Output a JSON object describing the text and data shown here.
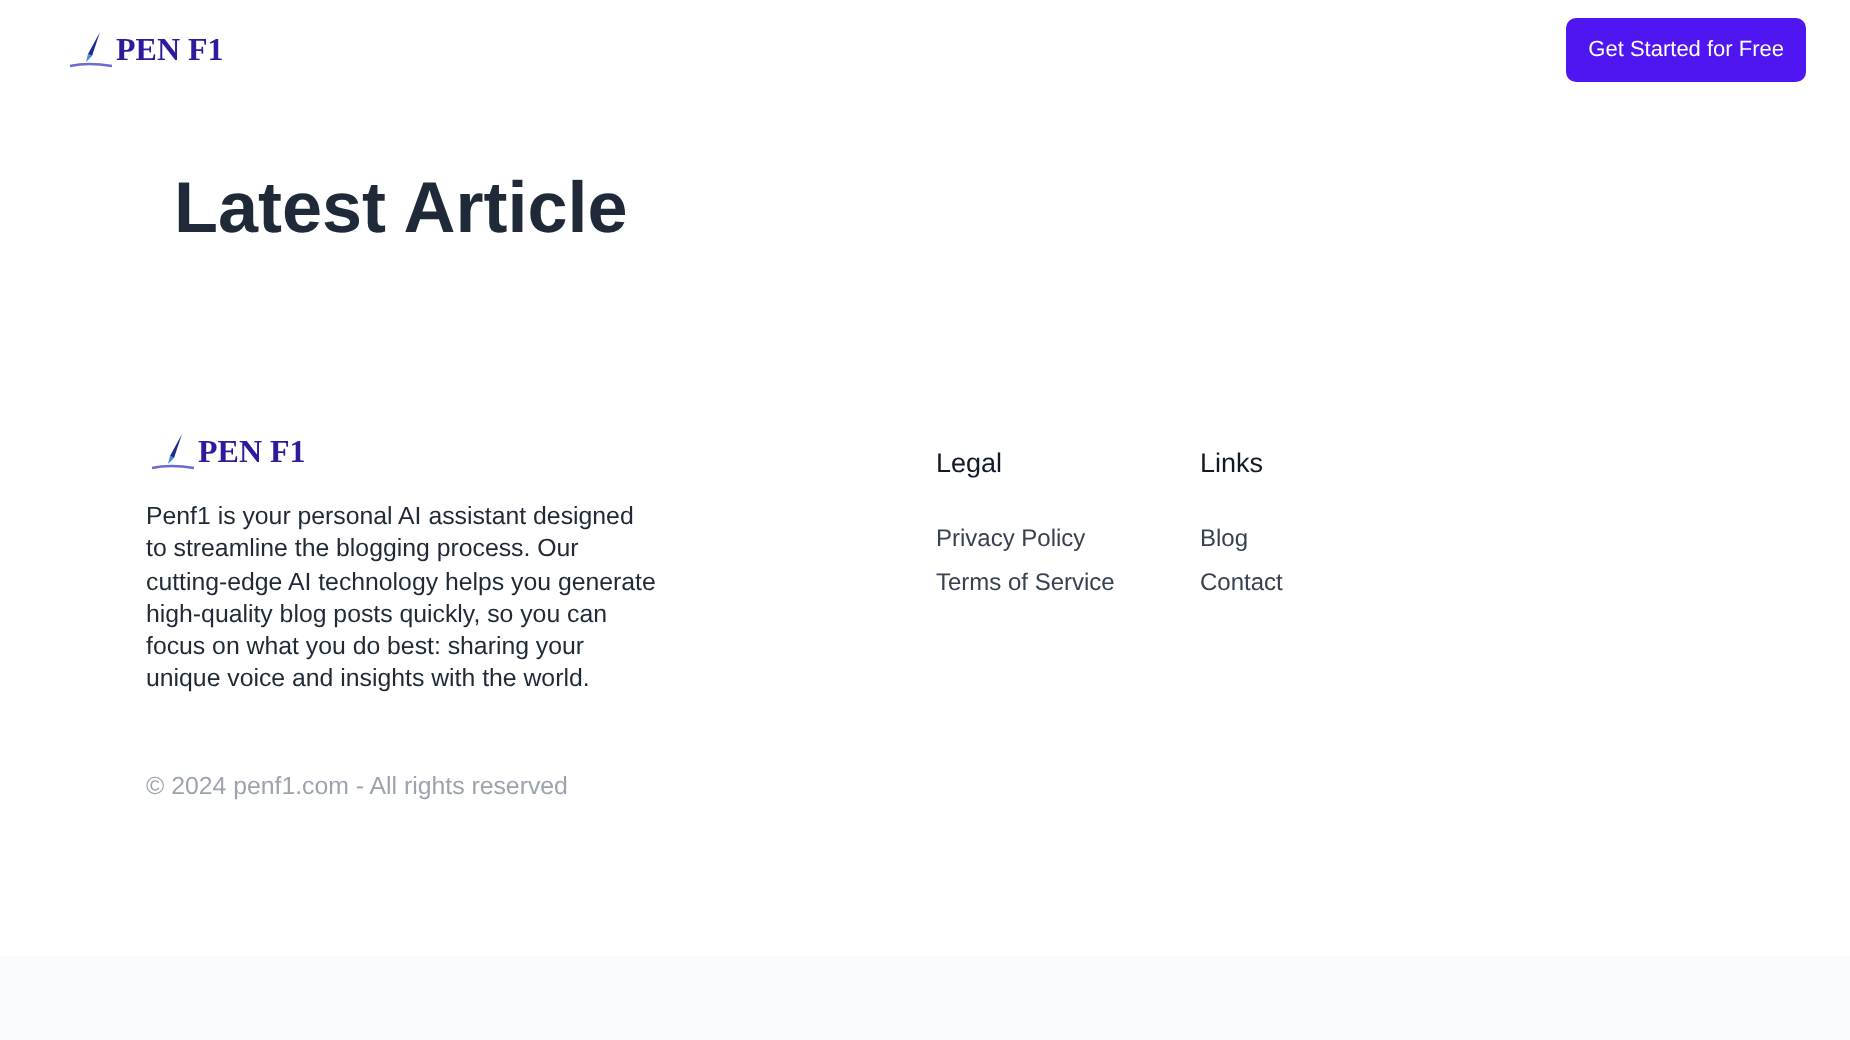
{
  "header": {
    "logo": "PEN F1",
    "cta": "Get Started for Free"
  },
  "heading": "Latest Article",
  "footer": {
    "logo": "PEN F1",
    "description": "Penf1 is your personal AI assistant designed to streamline the blogging process. Our cutting-edge AI technology helps you generate high-quality blog posts quickly, so you can focus on what you do best: sharing your unique voice and insights with the world.",
    "columns": [
      {
        "title": "Legal",
        "links": [
          "Privacy Policy",
          "Terms of Service"
        ]
      },
      {
        "title": "Links",
        "links": [
          "Blog",
          "Contact"
        ]
      }
    ],
    "copyright": "© 2024 penf1.com - All rights reserved"
  }
}
